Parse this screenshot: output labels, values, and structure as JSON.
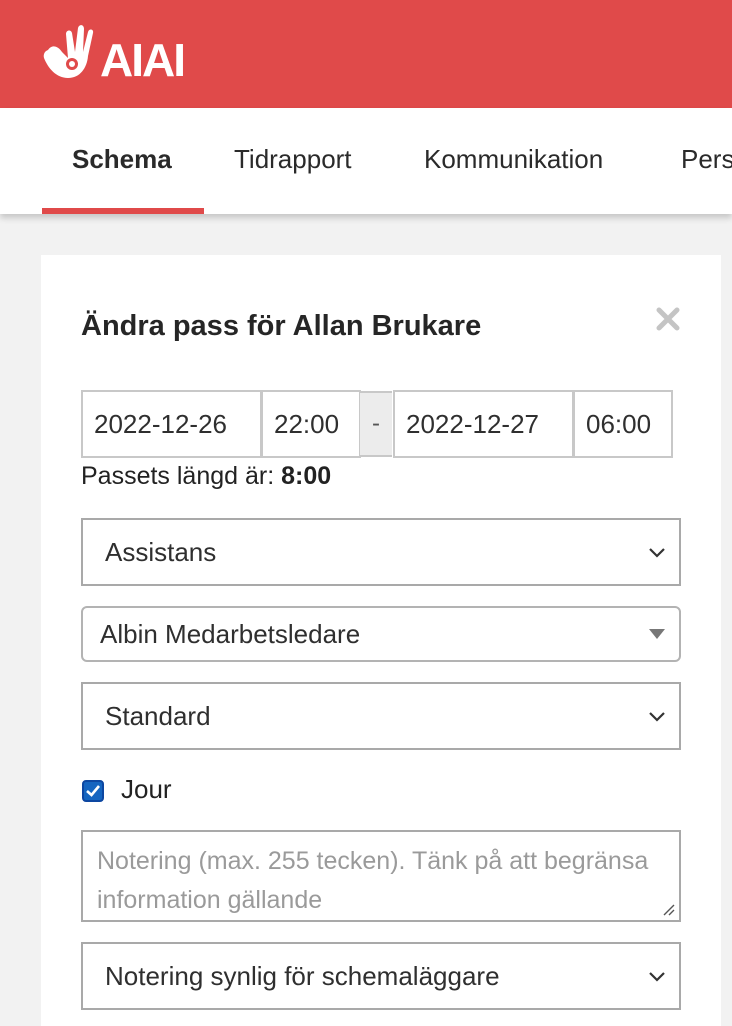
{
  "header": {
    "brand_color": "#e04a4a",
    "logo_icon": "hand-logo-icon",
    "logo_text": "AIAI"
  },
  "nav": {
    "tabs": [
      {
        "label": "Schema",
        "active": true
      },
      {
        "label": "Tidrapport",
        "active": false
      },
      {
        "label": "Kommunikation",
        "active": false
      },
      {
        "label": "Personal",
        "active": false
      }
    ]
  },
  "modal": {
    "title": "Ändra pass för Allan Brukare",
    "close_icon": "close-icon",
    "start_date": "2022-12-26",
    "start_time": "22:00",
    "separator": "-",
    "end_date": "2022-12-27",
    "end_time": "06:00",
    "duration_label": "Passets längd är:",
    "duration_value": "8:00",
    "shift_type_select": "Assistans",
    "manager_select": "Albin Medarbetsledare",
    "schedule_type_select": "Standard",
    "on_call": {
      "label": "Jour",
      "checked": true
    },
    "note": {
      "placeholder": "Notering (max. 255 tecken). Tänk på att begränsa information gällande",
      "value": ""
    },
    "note_visibility_select": "Notering synlig för schemaläggare"
  }
}
